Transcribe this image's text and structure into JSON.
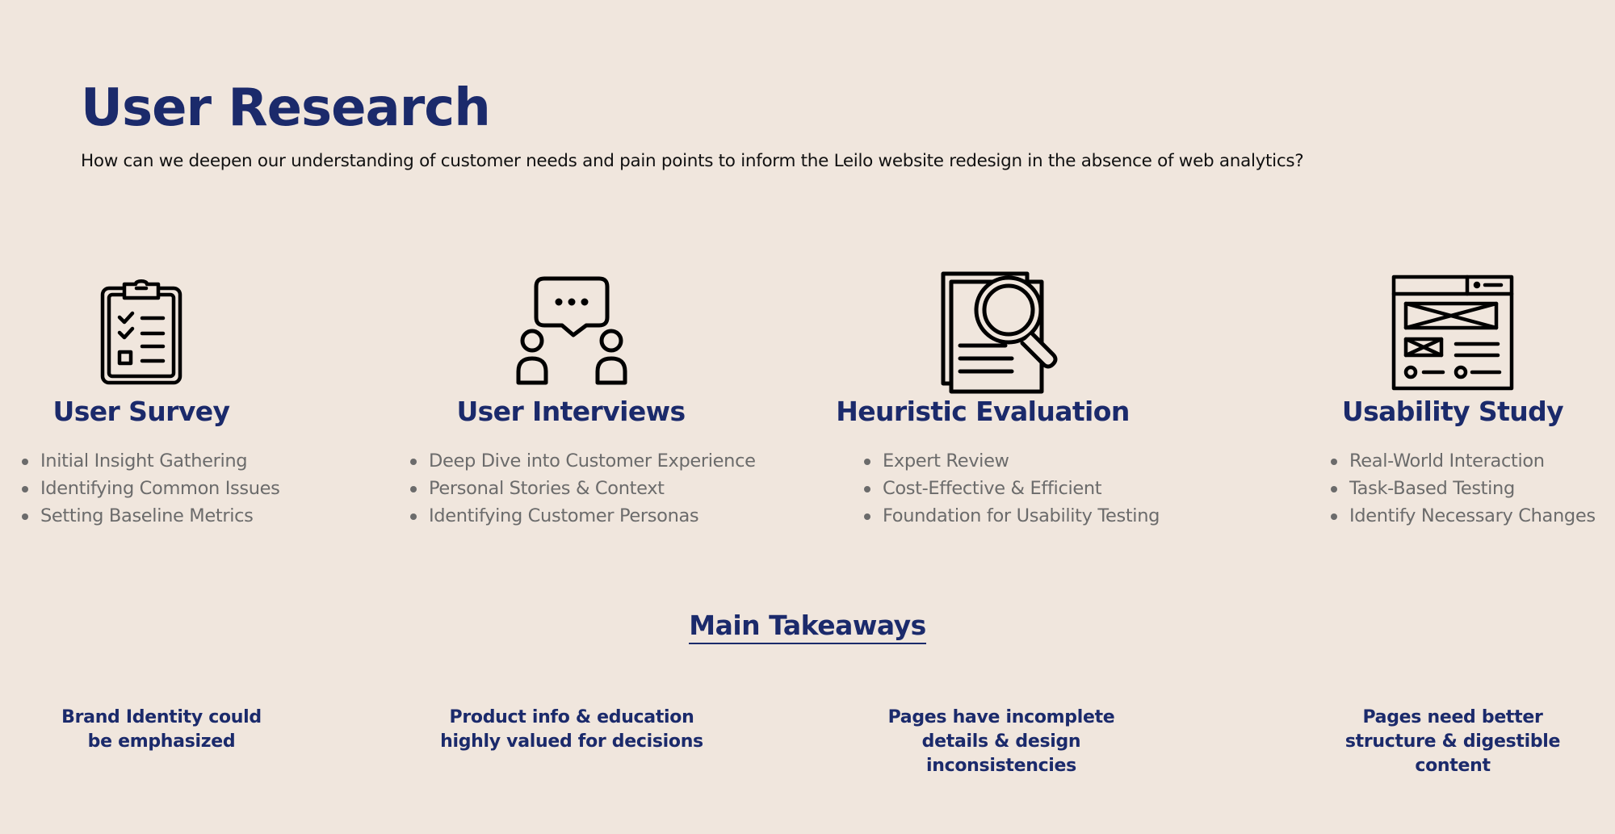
{
  "header": {
    "title": "User Research",
    "subtitle": "How can we deepen our understanding of customer needs and pain points to inform the Leilo website redesign in the absence of web analytics?"
  },
  "methods": [
    {
      "icon": "clipboard-checklist-icon",
      "title": "User Survey",
      "bullets": [
        "Initial Insight Gathering",
        "Identifying Common Issues",
        "Setting Baseline Metrics"
      ]
    },
    {
      "icon": "people-chat-icon",
      "title": "User Interviews",
      "bullets": [
        "Deep Dive into Customer Experience",
        "Personal Stories & Context",
        "Identifying Customer Personas"
      ]
    },
    {
      "icon": "document-magnifier-icon",
      "title": "Heuristic Evaluation",
      "bullets": [
        "Expert Review",
        "Cost-Effective & Efficient",
        "Foundation for Usability Testing"
      ]
    },
    {
      "icon": "wireframe-browser-icon",
      "title": "Usability Study",
      "bullets": [
        "Real-World Interaction",
        "Task-Based Testing",
        "Identify Necessary Changes"
      ]
    }
  ],
  "takeaways": {
    "heading": "Main Takeaways",
    "items": [
      "Brand Identity could be emphasized",
      "Product info & education highly valued for decisions",
      "Pages have incomplete details & design inconsistencies",
      "Pages need better structure & digestible content"
    ]
  },
  "colors": {
    "background": "#f0e6dd",
    "heading": "#1b2a6b",
    "body_text": "#111111",
    "bullet_text": "#6b6b6b"
  }
}
